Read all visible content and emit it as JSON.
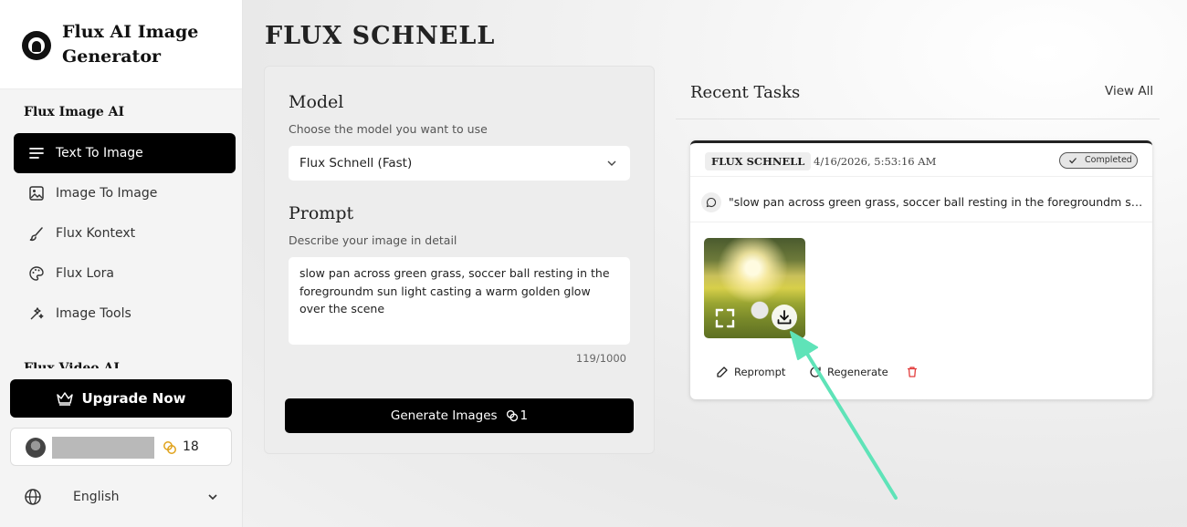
{
  "brand": {
    "title": "Flux AI Image Generator"
  },
  "sidebar": {
    "section_image": "Flux Image AI",
    "section_video": "Flux Video AI",
    "items": [
      {
        "label": "Text To Image",
        "icon": "text-lines-icon",
        "active": true
      },
      {
        "label": "Image To Image",
        "icon": "image-icon",
        "active": false
      },
      {
        "label": "Flux Kontext",
        "icon": "brush-icon",
        "active": false
      },
      {
        "label": "Flux Lora",
        "icon": "palette-icon",
        "active": false
      },
      {
        "label": "Image Tools",
        "icon": "wand-icon",
        "active": false
      }
    ],
    "upgrade_label": "Upgrade Now",
    "user": {
      "credits": "18"
    },
    "language": "English"
  },
  "main": {
    "page_title": "FLUX SCHNELL",
    "form": {
      "model_label": "Model",
      "model_hint": "Choose the model you want to use",
      "model_value": "Flux Schnell (Fast)",
      "prompt_label": "Prompt",
      "prompt_hint": "Describe your image in detail",
      "prompt_value": "slow pan across green grass, soccer ball resting in the foregroundm sun light casting a warm golden glow over the scene",
      "char_count": "119/1000",
      "generate_label": "Generate Images",
      "generate_cost": "1"
    },
    "recent": {
      "title": "Recent Tasks",
      "view_all": "View All",
      "task": {
        "model_tag": "FLUX SCHNELL",
        "timestamp": "4/16/2026, 5:53:16 AM",
        "status": "Completed",
        "prompt": "\"slow pan across green grass, soccer ball resting in the foregroundm sun light casting a warm golden glow over the scene\"",
        "actions": {
          "reprompt": "Reprompt",
          "regenerate": "Regenerate"
        }
      }
    }
  },
  "colors": {
    "accent": "#000000",
    "annotation_arrow": "#5fe3b8",
    "delete": "#e23b3b",
    "credits": "#e0a21a"
  }
}
